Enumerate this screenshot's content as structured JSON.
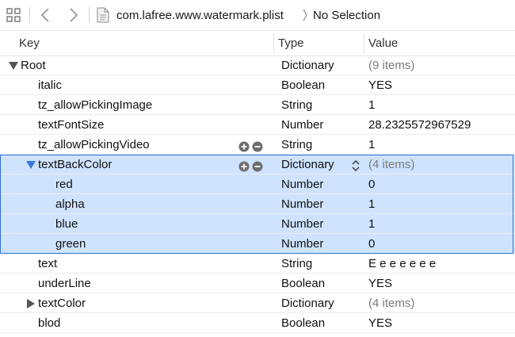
{
  "toolbar": {
    "grid_icon": "grid-icon",
    "back_icon": "chevron-left-icon",
    "forward_icon": "chevron-right-icon",
    "file_icon": "plist-file-icon",
    "filename": "com.lafree.www.watermark.plist",
    "selection": "No Selection"
  },
  "columns": {
    "key": "Key",
    "type": "Type",
    "value": "Value"
  },
  "rows": [
    {
      "key": "Root",
      "type": "Dictionary",
      "value": "(9 items)"
    },
    {
      "key": "italic",
      "type": "Boolean",
      "value": "YES"
    },
    {
      "key": "tz_allowPickingImage",
      "type": "String",
      "value": "1"
    },
    {
      "key": "textFontSize",
      "type": "Number",
      "value": "28.2325572967529"
    },
    {
      "key": "tz_allowPickingVideo",
      "type": "String",
      "value": "1"
    },
    {
      "key": "textBackColor",
      "type": "Dictionary",
      "value": "(4 items)"
    },
    {
      "key": "red",
      "type": "Number",
      "value": "0"
    },
    {
      "key": "alpha",
      "type": "Number",
      "value": "1"
    },
    {
      "key": "blue",
      "type": "Number",
      "value": "1"
    },
    {
      "key": "green",
      "type": "Number",
      "value": "0"
    },
    {
      "key": "text",
      "type": "String",
      "value": "E e e e e e e"
    },
    {
      "key": "underLine",
      "type": "Boolean",
      "value": "YES"
    },
    {
      "key": "textColor",
      "type": "Dictionary",
      "value": "(4 items)"
    },
    {
      "key": "blod",
      "type": "Boolean",
      "value": "YES"
    }
  ],
  "colors": {
    "selection": "#cfe3ff",
    "selection_border": "#2f6fdb",
    "muted": "#7a7a7a"
  }
}
